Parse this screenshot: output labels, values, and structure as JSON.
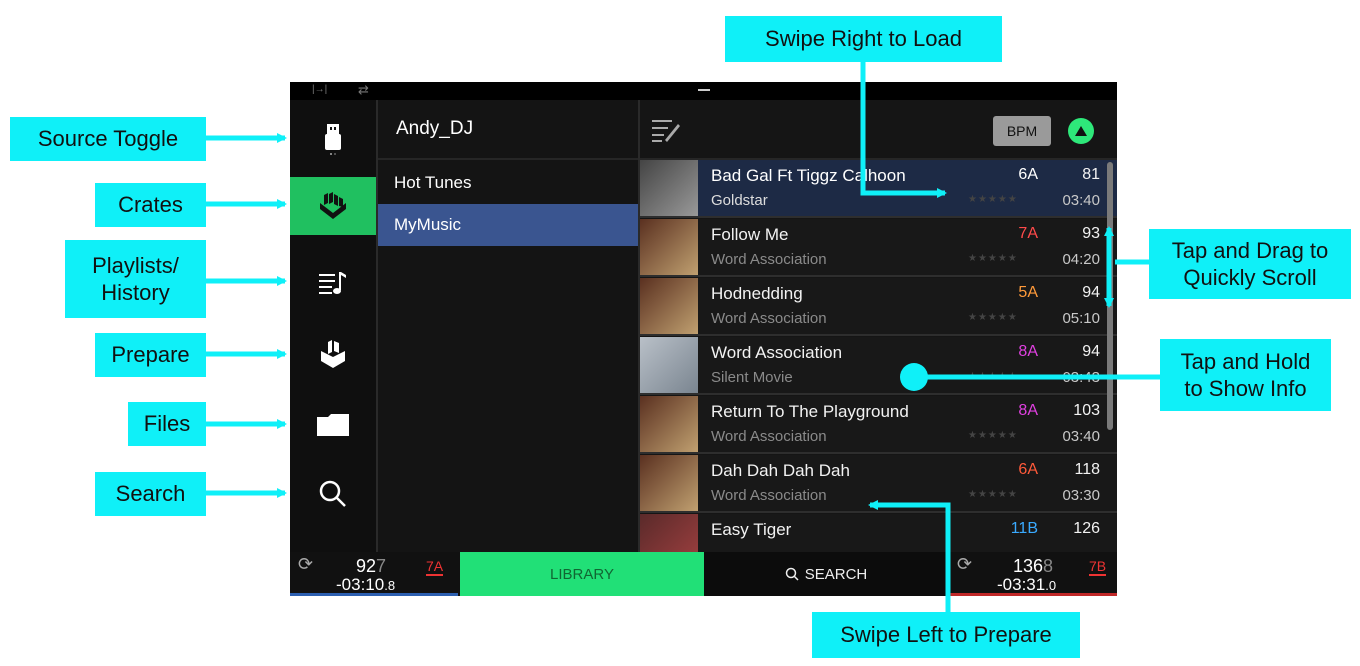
{
  "callouts": {
    "source_toggle": "Source Toggle",
    "crates": "Crates",
    "playlists_line1": "Playlists/",
    "playlists_line2": "History",
    "prepare": "Prepare",
    "files": "Files",
    "search": "Search",
    "swipe_right": "Swipe Right to Load",
    "tap_drag_line1": "Tap and Drag to",
    "tap_drag_line2": "Quickly Scroll",
    "tap_hold_line1": "Tap and Hold",
    "tap_hold_line2": "to Show Info",
    "swipe_left": "Swipe Left to Prepare"
  },
  "sidebar": {
    "items": [
      {
        "name": "source-toggle",
        "icon": "usb-drive-icon"
      },
      {
        "name": "crates",
        "icon": "crates-icon",
        "active": true
      },
      {
        "name": "playlists-history",
        "icon": "playlist-icon"
      },
      {
        "name": "prepare",
        "icon": "prepare-box-icon"
      },
      {
        "name": "files",
        "icon": "folder-icon"
      },
      {
        "name": "search",
        "icon": "search-icon"
      }
    ]
  },
  "crates_panel": {
    "header": "Andy_DJ",
    "items": [
      "Hot Tunes",
      "MyMusic"
    ],
    "selected": "MyMusic"
  },
  "track_header": {
    "bpm_label": "BPM",
    "sort_icon": "sort-up-icon",
    "edit_icon": "edit-list-icon"
  },
  "tracks": [
    {
      "title": "Bad Gal Ft Tiggz Calhoon",
      "artist": "Goldstar",
      "key": "6A",
      "key_color": "#ffffff",
      "bpm": "81",
      "time": "03:40",
      "stars": "★★★★★"
    },
    {
      "title": "Follow Me",
      "artist": "Word Association",
      "key": "7A",
      "key_color": "#ff4a4a",
      "bpm": "93",
      "time": "04:20",
      "stars": "★★★★★"
    },
    {
      "title": "Hodnedding",
      "artist": "Word Association",
      "key": "5A",
      "key_color": "#ff9a3a",
      "bpm": "94",
      "time": "05:10",
      "stars": "★★★★★"
    },
    {
      "title": "Word Association",
      "artist": "Silent Movie",
      "key": "8A",
      "key_color": "#e040e0",
      "bpm": "94",
      "time": "03:43",
      "stars": "★★★★★"
    },
    {
      "title": "Return To The Playground",
      "artist": "Word Association",
      "key": "8A",
      "key_color": "#e040e0",
      "bpm": "103",
      "time": "03:40",
      "stars": "★★★★★"
    },
    {
      "title": "Dah Dah Dah Dah",
      "artist": "Word Association",
      "key": "6A",
      "key_color": "#ff5a3a",
      "bpm": "118",
      "time": "03:30",
      "stars": "★★★★★"
    },
    {
      "title": "Easy Tiger",
      "artist": "",
      "key": "11B",
      "key_color": "#3aaaff",
      "bpm": "126",
      "time": "",
      "stars": ""
    }
  ],
  "deck_left": {
    "bpm_main": "92",
    "bpm_decimal": "7",
    "key": "7A",
    "time_main": "-03:10",
    "time_decimal": ".8"
  },
  "deck_right": {
    "bpm_main": "136",
    "bpm_decimal": "8",
    "key": "7B",
    "time_main": "-03:31",
    "time_decimal": ".0"
  },
  "bottom": {
    "library_label": "LIBRARY",
    "search_label": "SEARCH"
  }
}
